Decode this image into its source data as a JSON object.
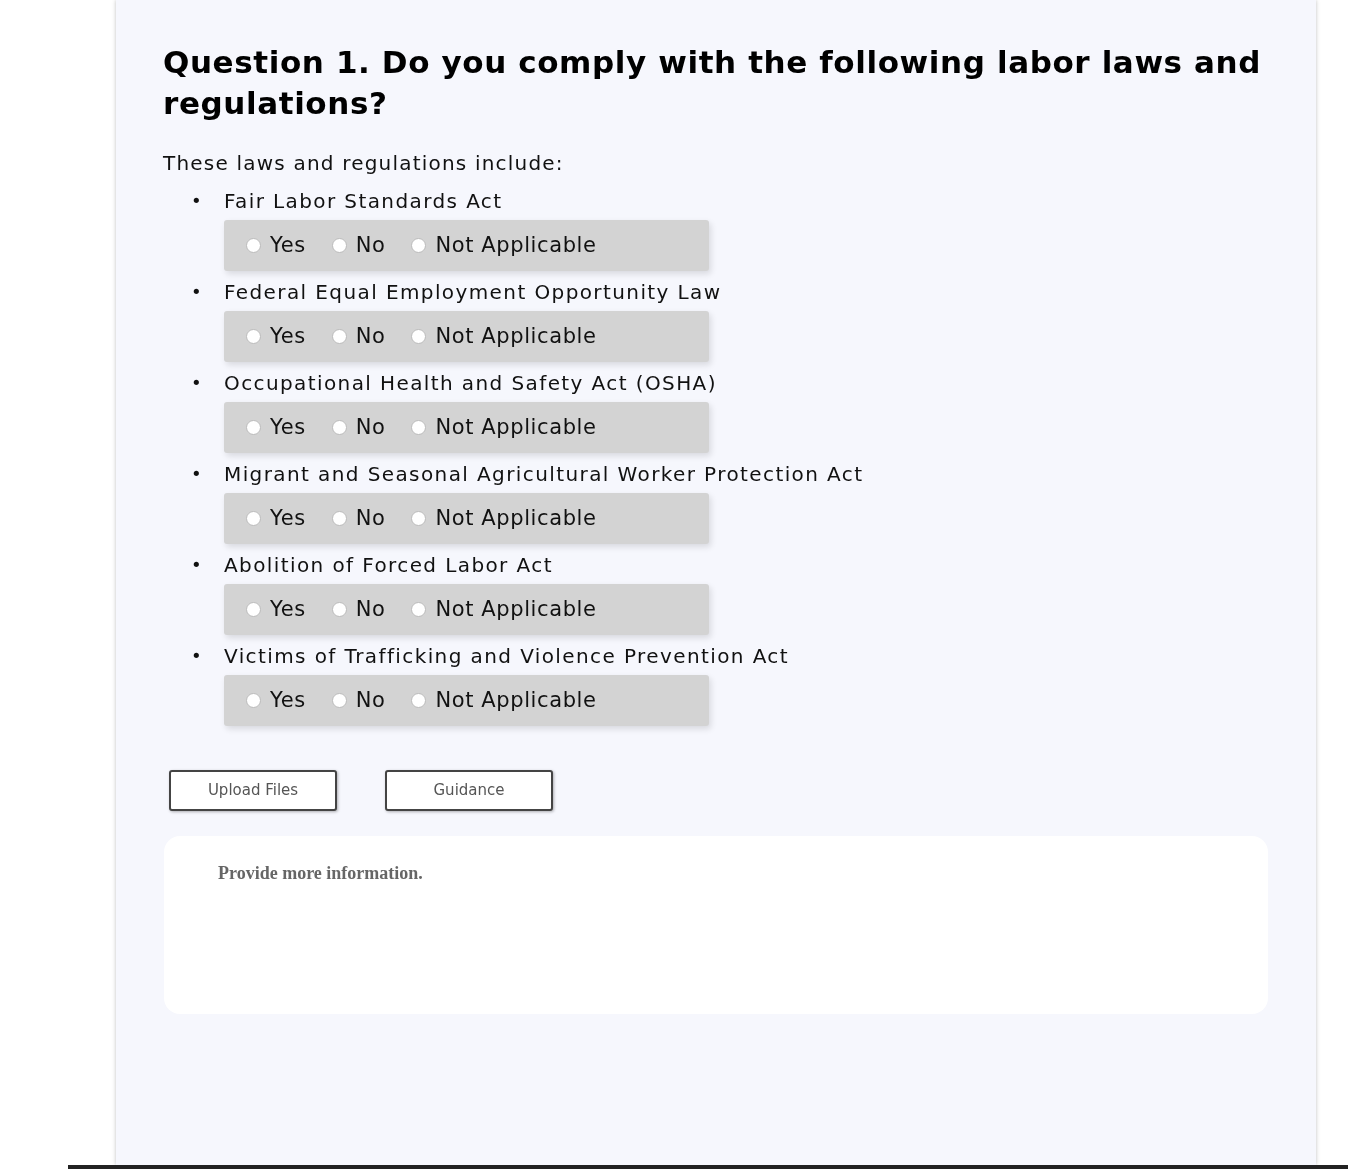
{
  "question": {
    "title": "Question 1. Do you comply with the following labor laws and regulations?",
    "intro": "These laws and regulations include:",
    "laws": [
      {
        "marker": "•",
        "name": "Fair Labor Standards Act",
        "options": [
          {
            "label": "Yes",
            "selected": false
          },
          {
            "label": "No",
            "selected": false
          },
          {
            "label": "Not Applicable",
            "selected": false
          }
        ]
      },
      {
        "marker": "•",
        "name": "Federal Equal Employment Opportunity Law",
        "options": [
          {
            "label": "Yes",
            "selected": false
          },
          {
            "label": "No",
            "selected": false
          },
          {
            "label": "Not Applicable",
            "selected": false
          }
        ]
      },
      {
        "marker": "•",
        "name": "Occupational Health and Safety Act (OSHA)",
        "options": [
          {
            "label": "Yes",
            "selected": false
          },
          {
            "label": "No",
            "selected": false
          },
          {
            "label": "Not Applicable",
            "selected": false
          }
        ]
      },
      {
        "marker": "•",
        "name": "Migrant and Seasonal Agricultural Worker Protection Act",
        "options": [
          {
            "label": "Yes",
            "selected": false
          },
          {
            "label": "No",
            "selected": false
          },
          {
            "label": "Not Applicable",
            "selected": false
          }
        ]
      },
      {
        "marker": "•",
        "name": "Abolition of Forced Labor Act",
        "options": [
          {
            "label": "Yes",
            "selected": false
          },
          {
            "label": "No",
            "selected": false
          },
          {
            "label": "Not Applicable",
            "selected": false
          }
        ]
      },
      {
        "marker": "•",
        "name": "Victims of Trafficking and Violence Prevention Act",
        "options": [
          {
            "label": "Yes",
            "selected": false
          },
          {
            "label": "No",
            "selected": false
          },
          {
            "label": "Not Applicable",
            "selected": false
          }
        ]
      }
    ],
    "buttons": [
      "Upload Files",
      "Guidance"
    ],
    "details": {
      "placeholder": "Provide more information."
    }
  }
}
